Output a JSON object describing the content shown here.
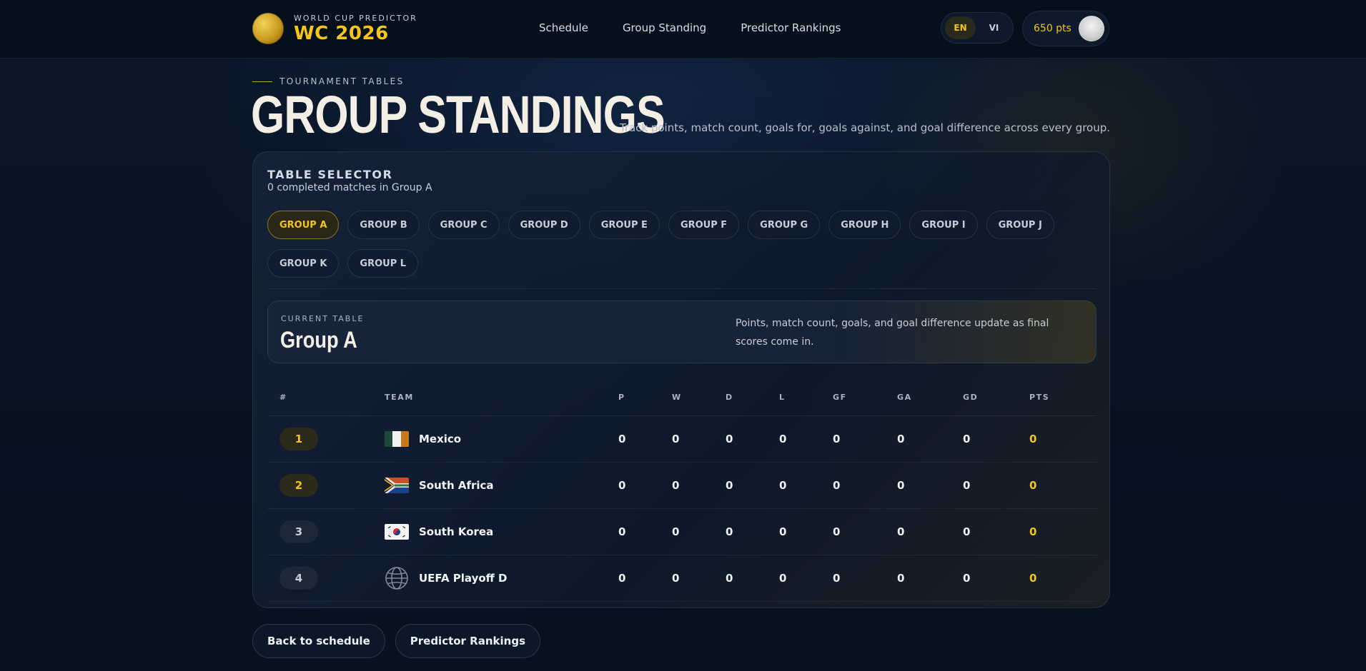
{
  "header": {
    "brand_sub": "WORLD CUP PREDICTOR",
    "brand_title": "WC 2026",
    "nav": [
      "Schedule",
      "Group Standing",
      "Predictor Rankings"
    ],
    "lang": [
      "EN",
      "VI"
    ],
    "points": "650 pts"
  },
  "hero": {
    "eyebrow": "TOURNAMENT TABLES",
    "title": "GROUP STANDINGS",
    "description": "Track points, match count, goals for, goals against, and goal difference across every group."
  },
  "selector": {
    "title": "TABLE SELECTOR",
    "subtitle": "0 completed matches in Group A",
    "groups": [
      "GROUP A",
      "GROUP B",
      "GROUP C",
      "GROUP D",
      "GROUP E",
      "GROUP F",
      "GROUP G",
      "GROUP H",
      "GROUP I",
      "GROUP J",
      "GROUP K",
      "GROUP L"
    ],
    "active": "GROUP A"
  },
  "current": {
    "label": "CURRENT TABLE",
    "name": "Group A",
    "description": "Points, match count, goals, and goal difference update as final scores come in."
  },
  "table": {
    "headers": [
      "#",
      "TEAM",
      "P",
      "W",
      "D",
      "L",
      "GF",
      "GA",
      "GD",
      "PTS"
    ],
    "rows": [
      {
        "rank": "1",
        "team": "Mexico",
        "flag": "mexico-flag-icon",
        "p": "0",
        "w": "0",
        "d": "0",
        "l": "0",
        "gf": "0",
        "ga": "0",
        "gd": "0",
        "pts": "0"
      },
      {
        "rank": "2",
        "team": "South Africa",
        "flag": "south-africa-flag-icon",
        "p": "0",
        "w": "0",
        "d": "0",
        "l": "0",
        "gf": "0",
        "ga": "0",
        "gd": "0",
        "pts": "0"
      },
      {
        "rank": "3",
        "team": "South Korea",
        "flag": "south-korea-flag-icon",
        "p": "0",
        "w": "0",
        "d": "0",
        "l": "0",
        "gf": "0",
        "ga": "0",
        "gd": "0",
        "pts": "0"
      },
      {
        "rank": "4",
        "team": "UEFA Playoff D",
        "flag": "globe-icon",
        "p": "0",
        "w": "0",
        "d": "0",
        "l": "0",
        "gf": "0",
        "ga": "0",
        "gd": "0",
        "pts": "0"
      }
    ]
  },
  "footer": {
    "back": "Back to schedule",
    "rankings": "Predictor Rankings"
  },
  "colors": {
    "accent": "#f5c518",
    "background": "#07111f"
  }
}
